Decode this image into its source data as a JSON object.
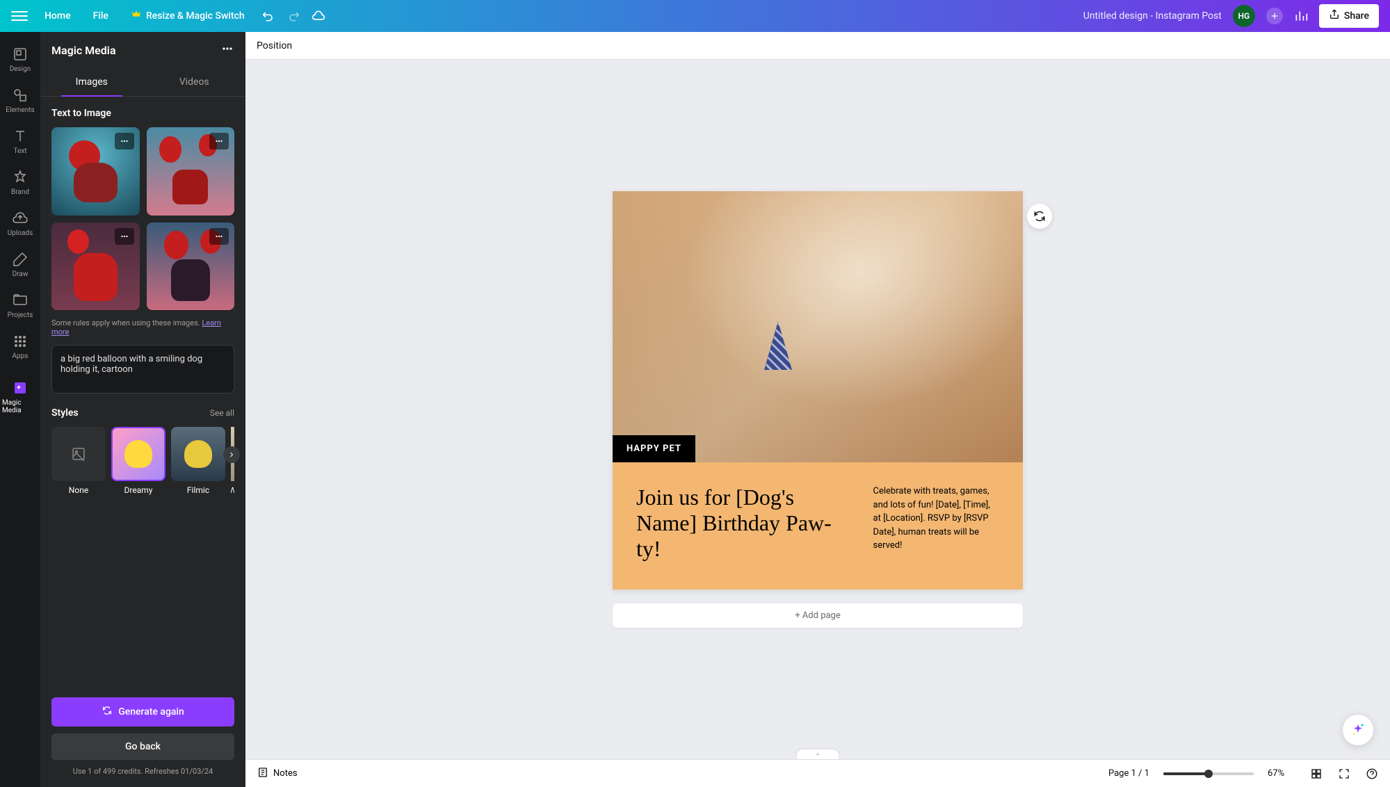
{
  "topbar": {
    "home": "Home",
    "file": "File",
    "resize": "Resize & Magic Switch",
    "title": "Untitled design - Instagram Post",
    "avatar": "HG",
    "share": "Share"
  },
  "nav": {
    "items": [
      {
        "label": "Design",
        "icon": "design"
      },
      {
        "label": "Elements",
        "icon": "elements"
      },
      {
        "label": "Text",
        "icon": "text"
      },
      {
        "label": "Brand",
        "icon": "brand"
      },
      {
        "label": "Uploads",
        "icon": "uploads"
      },
      {
        "label": "Draw",
        "icon": "draw"
      },
      {
        "label": "Projects",
        "icon": "projects"
      },
      {
        "label": "Apps",
        "icon": "apps"
      },
      {
        "label": "Magic Media",
        "icon": "magic-media"
      }
    ]
  },
  "panel": {
    "title": "Magic Media",
    "tabs": [
      "Images",
      "Videos"
    ],
    "active_tab": "Images",
    "section_label": "Text to Image",
    "rules_text": "Some rules apply when using these images.",
    "learn_more": "Learn more",
    "prompt": "a big red balloon with a smiling dog holding it, cartoon",
    "styles_label": "Styles",
    "see_all": "See all",
    "styles": [
      {
        "name": "None"
      },
      {
        "name": "Dreamy"
      },
      {
        "name": "Filmic"
      },
      {
        "name": "W"
      }
    ],
    "generate_btn": "Generate again",
    "goback_btn": "Go back",
    "credits": "Use 1 of 499 credits. Refreshes 01/03/24"
  },
  "canvas": {
    "position": "Position",
    "hero_label": "HAPPY PET",
    "headline": "Join us for [Dog's Name] Birthday Paw-ty!",
    "body": "Celebrate with treats, games, and lots of fun! [Date], [Time], at [Location]. RSVP by [RSVP Date], human treats will be served!",
    "add_page": "+ Add page"
  },
  "bottom": {
    "notes": "Notes",
    "page_indicator": "Page 1 / 1",
    "zoom": "67%"
  }
}
